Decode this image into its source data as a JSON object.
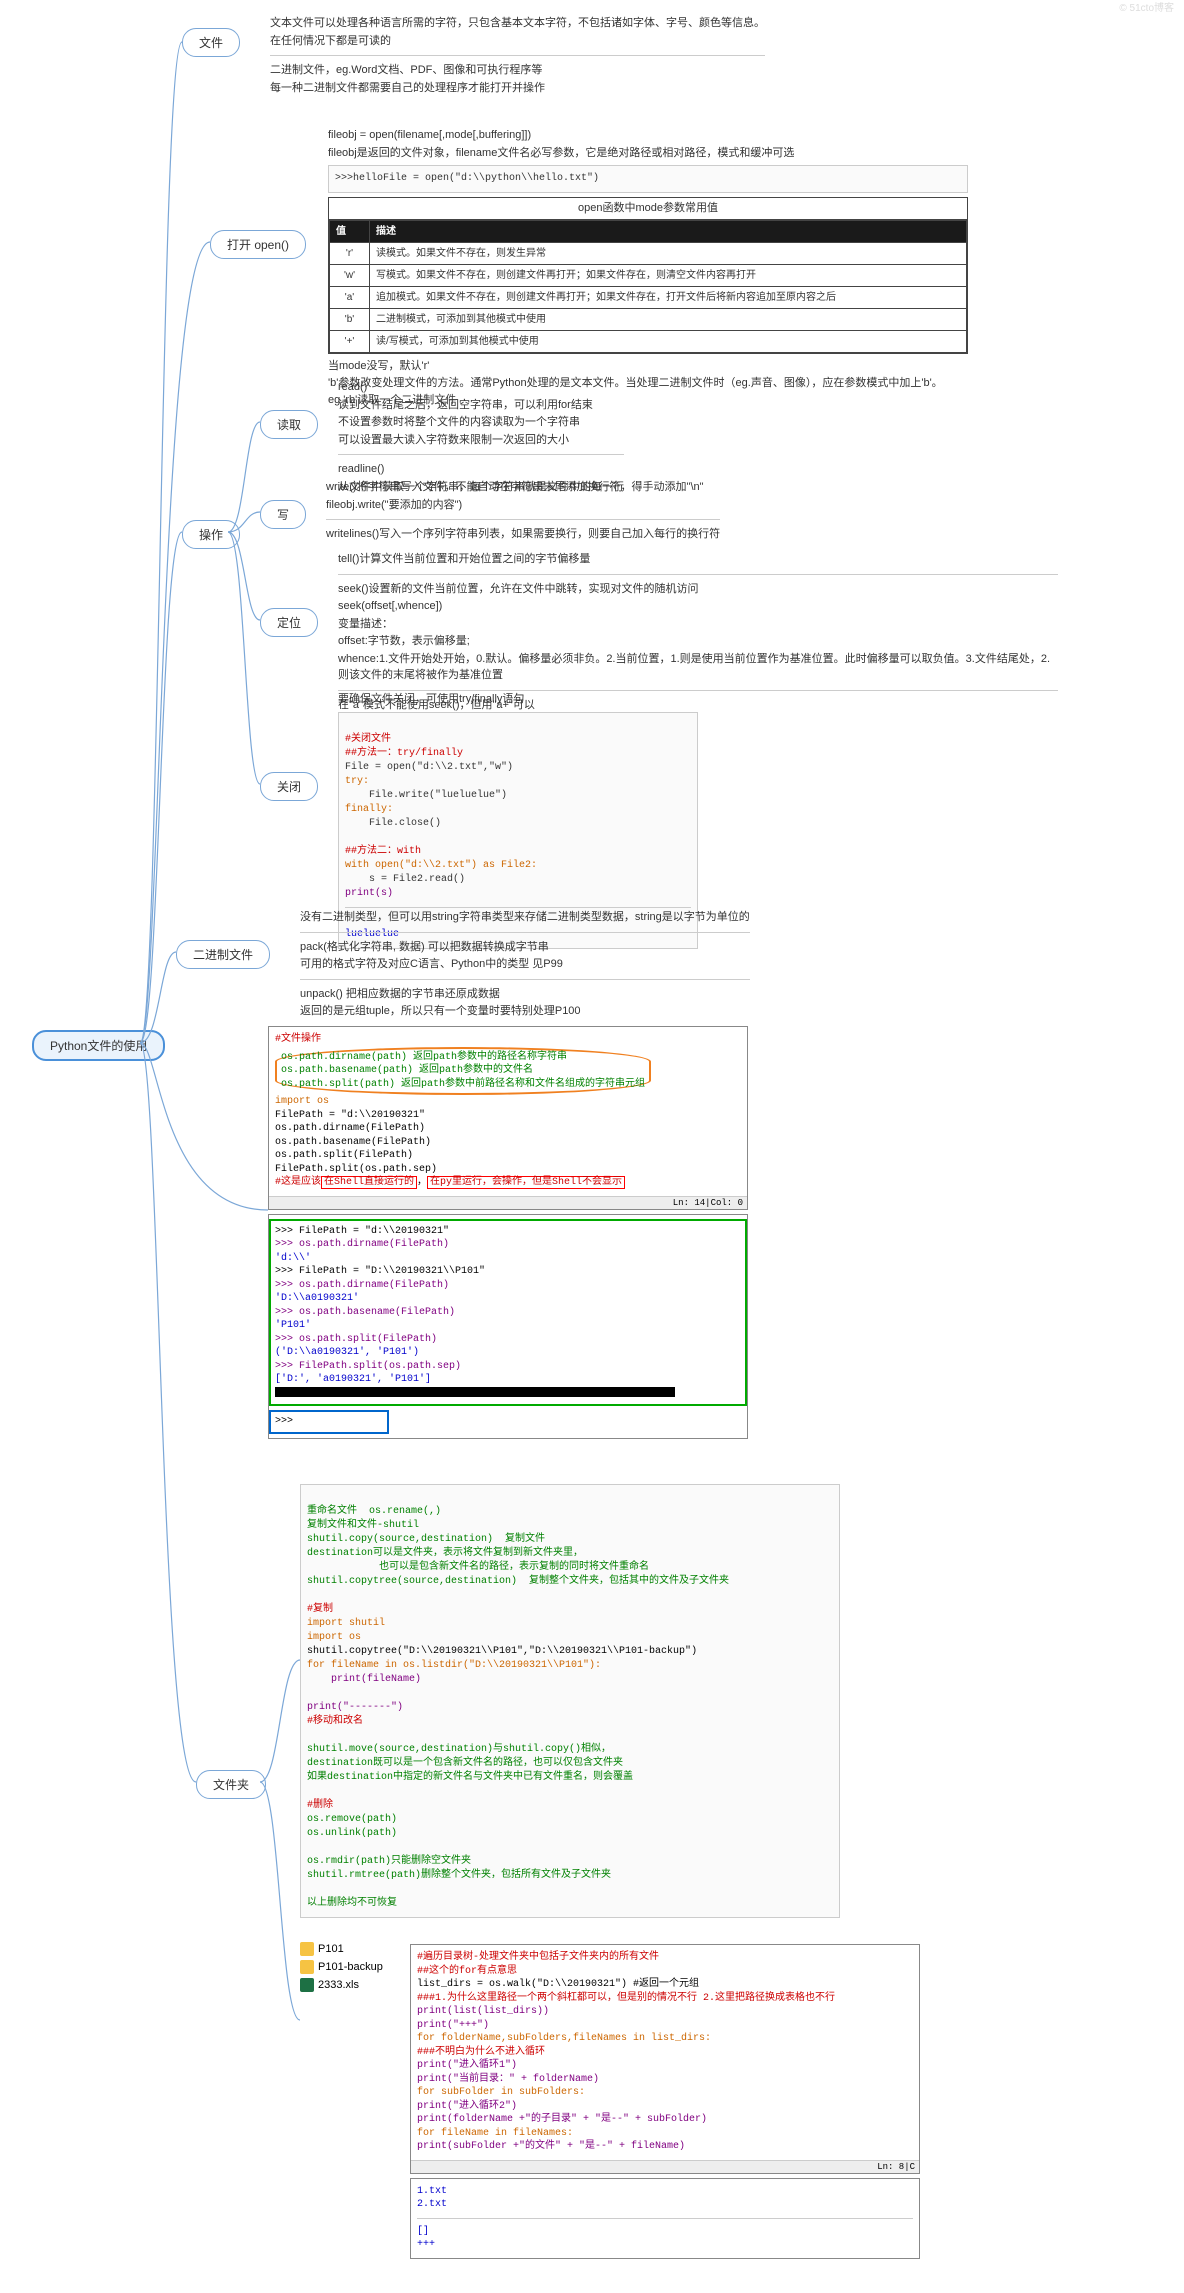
{
  "root": "Python文件的使用",
  "nodes": {
    "file": "文件",
    "open": "打开 open()",
    "ops": "操作",
    "read": "读取",
    "write": "写",
    "seek": "定位",
    "close": "关闭",
    "binary": "二进制文件",
    "folder": "文件夹"
  },
  "file_desc": {
    "l1": "文本文件可以处理各种语言所需的字符，只包含基本文本字符，不包括诸如字体、字号、颜色等信息。",
    "l2": "在任何情况下都是可读的",
    "l3": "二进制文件，eg.Word文档、PDF、图像和可执行程序等",
    "l4": "每一种二进制文件都需要自己的处理程序才能打开并操作"
  },
  "open_desc": {
    "l1": "fileobj = open(filename[,mode[,buffering]])",
    "l2": "fileobj是返回的文件对象，filename文件名必写参数，它是绝对路径或相对路径，模式和缓冲可选",
    "code1": ">>>helloFile = open(\"d:\\\\python\\\\hello.txt\")",
    "tbl_title": "open函数中mode参数常用值",
    "th1": "值",
    "th2": "描述",
    "r1v": "'r'",
    "r1d": "读模式。如果文件不存在，则发生异常",
    "r2v": "'w'",
    "r2d": "写模式。如果文件不存在，则创建文件再打开；如果文件存在，则清空文件内容再打开",
    "r3v": "'a'",
    "r3d": "追加模式。如果文件不存在，则创建文件再打开；如果文件存在，打开文件后将新内容追加至原内容之后",
    "r4v": "'b'",
    "r4d": "二进制模式，可添加到其他模式中使用",
    "r5v": "'+'",
    "r5d": "读/写模式，可添加到其他模式中使用",
    "l3": "当mode没写，默认'r'",
    "l4": "'b'参数改变处理文件的方法。通常Python处理的是文本文件。当处理二进制文件时（eg.声音、图像），应在参数模式中加上'b'。eg.'rb'读取一个二进制文件"
  },
  "read_desc": {
    "h1": "read()",
    "l1": "读到文件结尾之后，返回空字符串，可以利用for结束",
    "l2": "不设置参数时将整个文件的内容读取为一个字符串",
    "l3": "可以设置最大读入字符数来限制一次返回的大小",
    "h2": "readline()",
    "l4": "从文件中获取一个字符串，每个字符串就是文件中的每一行"
  },
  "write_desc": {
    "l1": "write()将字符串写入文件，不能自动在字符串末尾添加换行符，得手动添加\"\\n\"",
    "l2": "fileobj.write(\"要添加的内容\")",
    "l3": "writelines()写入一个序列字符串列表，如果需要换行，则要自己加入每行的换行符"
  },
  "seek_desc": {
    "l1": "tell()计算文件当前位置和开始位置之间的字节偏移量",
    "l2": "seek()设置新的文件当前位置，允许在文件中跳转，实现对文件的随机访问",
    "l3": "seek(offset[,whence])",
    "l4": "变量描述：",
    "l5": "offset:字节数，表示偏移量;",
    "l6": "whence:1.文件开始处开始，0.默认。偏移量必须非负。2.当前位置，1.则是使用当前位置作为基准位置。此时偏移量可以取负值。3.文件结尾处，2.则该文件的末尾将被作为基准位置",
    "l7": "在\"a\"模式不能使用seek()，但用\"a+\"可以"
  },
  "close_desc": {
    "l1": "要确保文件关闭，可使用try/finally语句",
    "c_title": "#关闭文件",
    "c1": "##方法一：try/finally",
    "c2": "File = open(\"d:\\\\2.txt\",\"w\")",
    "c3": "try:",
    "c4": "    File.write(\"lueluelue\")",
    "c5": "finally:",
    "c6": "    File.close()",
    "c7": "",
    "c8": "##方法二：with",
    "c9": "with open(\"d:\\\\2.txt\") as File2:",
    "c10": "    s = File2.read()",
    "c11": "print(s)",
    "out": "lueluelue"
  },
  "binary_desc": {
    "l1": "没有二进制类型，但可以用string字符串类型来存储二进制类型数据，string是以字节为单位的",
    "l2": "pack(格式化字符串, 数据) 可以把数据转换成字节串",
    "l3": "可用的格式字符及对应C语言、Python中的类型  见P99",
    "l4": "unpack() 把相应数据的字节串还原成数据",
    "l5": "返回的是元组tuple，所以只有一个变量时要特别处理P100"
  },
  "idle1": {
    "t": "#文件操作",
    "a1": "os.path.dirname(path) 返回path参数中的路径名称字符串",
    "a2": "os.path.basename(path) 返回path参数中的文件名",
    "a3": "os.path.split(path) 返回path参数中前路径名称和文件名组成的字符串元组",
    "c1": "import os",
    "c2": "FilePath = \"d:\\\\20190321\"",
    "c3": "os.path.dirname(FilePath)",
    "c4": "os.path.basename(FilePath)",
    "c5": "os.path.split(FilePath)",
    "c6": "FilePath.split(os.path.sep)",
    "note": "#这是应该",
    "note_red1": "在Shell直接运行的",
    "note_mid": "，",
    "note_red2": "在py里运行，会操作，但是Shell不会显示",
    "status": "Ln: 14|Col: 0",
    "s1": ">>> FilePath = \"d:\\\\20190321\"",
    "s2": ">>> os.path.dirname(FilePath)",
    "s3": "'d:\\\\'",
    "s4": ">>> FilePath = \"D:\\\\20190321\\\\P101\"",
    "s5": ">>> os.path.dirname(FilePath)",
    "s6": "'D:\\\\a0190321'",
    "s7": ">>> os.path.basename(FilePath)",
    "s8": "'P101'",
    "s9": ">>> os.path.split(FilePath)",
    "s10": "('D:\\\\a0190321', 'P101')",
    "s11": ">>> FilePath.split(os.path.sep)",
    "s12": "['D:', 'a0190321', 'P101']",
    "s13": ">>>",
    "s14": ">>>"
  },
  "folder_code": {
    "h1": "重命名文件  os.rename(,)",
    "h2": "复制文件和文件-shutil",
    "h3": "shutil.copy(source,destination)  复制文件",
    "h4": "destination可以是文件夹，表示将文件复制到新文件夹里，",
    "h5": "            也可以是包含新文件名的路径，表示复制的同时将文件重命名",
    "h6": "shutil.copytree(source,destination)  复制整个文件夹，包括其中的文件及子文件夹",
    "sec1": "#复制",
    "c1": "import shutil",
    "c2": "import os",
    "c3": "shutil.copytree(\"D:\\\\20190321\\\\P101\",\"D:\\\\20190321\\\\P101-backup\")",
    "c4": "for fileName in os.listdir(\"D:\\\\20190321\\\\P101\"):",
    "c5": "    print(fileName)",
    "c6": "",
    "c7": "print(\"-------\")",
    "sec2": "#移动和改名",
    "m1": "shutil.move(source,destination)与shutil.copy()相似，",
    "m2": "destination既可以是一个包含新文件名的路径，也可以仅包含文件夹",
    "m3": "如果destination中指定的新文件名与文件夹中已有文件重名，则会覆盖",
    "sec3": "#删除",
    "d1": "os.remove(path)",
    "d2": "os.unlink(path)",
    "d3": "",
    "d4": "os.rmdir(path)只能删除空文件夹",
    "d5": "shutil.rmtree(path)删除整个文件夹，包括所有文件及子文件夹",
    "d6": "",
    "d7": "以上删除均不可恢复"
  },
  "files": {
    "f1": "P101",
    "f2": "P101-backup",
    "f3": "2333.xls"
  },
  "walk_code": {
    "t1": "#遍历目录树-处理文件夹中包括子文件夹内的所有文件",
    "t2": "##这个的for有点意思",
    "c1": "list_dirs = os.walk(\"D:\\\\20190321\")  #返回一个元组",
    "note1": "###1.为什么这里路径一个两个斜杠都可以，但是别的情况不行  2.这里把路径换成表格也不行",
    "c2": "print(list(list_dirs))",
    "c3": "print(\"+++\")",
    "c4": "for folderName,subFolders,fileNames in list_dirs:",
    "n2": "    ###不明白为什么不进入循环",
    "c5": "    print(\"进入循环1\")",
    "c6": "    print(\"当前目录：\" + folderName)",
    "c7": "    for subFolder in subFolders:",
    "c8": "        print(\"进入循环2\")",
    "c9": "        print(folderName +\"的子目录\" + \"是--\" + subFolder)",
    "c10": "        for fileName in fileNames:",
    "c11": "            print(subFolder +\"的文件\" + \"是--\" + fileName)",
    "status": "Ln: 8|C",
    "out1": "1.txt",
    "out2": "2.txt",
    "out3": "[]",
    "out4": "+++"
  },
  "watermark": "© 51cto博客"
}
